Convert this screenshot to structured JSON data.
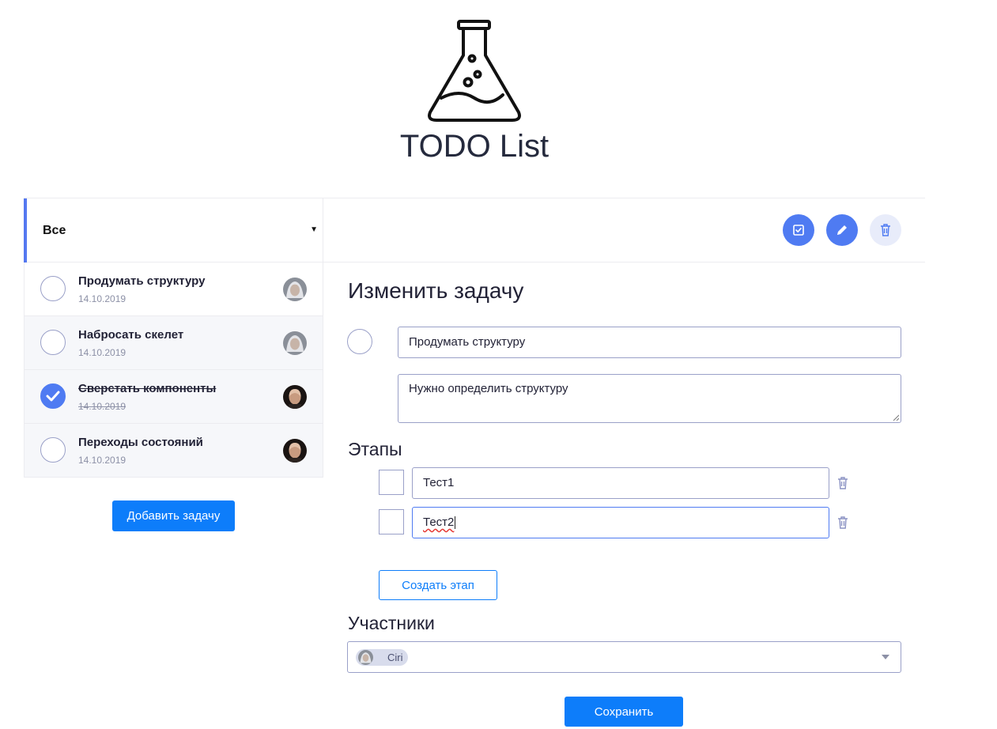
{
  "header": {
    "title": "TODO List",
    "logo_icon": "flask-icon"
  },
  "filter": {
    "label": "Все"
  },
  "toolbar": {
    "icons": [
      "checkbox-icon",
      "pencil-icon",
      "trash-icon"
    ]
  },
  "tasks": [
    {
      "title": "Продумать структуру",
      "date": "14.10.2019",
      "done": false,
      "avatar": "white-haired-avatar"
    },
    {
      "title": "Набросать скелет",
      "date": "14.10.2019",
      "done": false,
      "avatar": "white-haired-avatar"
    },
    {
      "title": "Сверстать компоненты",
      "date": "14.10.2019",
      "done": true,
      "avatar": "bald-man-avatar"
    },
    {
      "title": "Переходы состояний",
      "date": "14.10.2019",
      "done": false,
      "avatar": "bald-man-avatar"
    }
  ],
  "add_task_label": "Добавить задачу",
  "editor": {
    "heading": "Изменить задачу",
    "title_value": "Продумать структуру",
    "description_value": "Нужно определить структуру",
    "stages_heading": "Этапы",
    "stages": [
      {
        "value": "Тест1"
      },
      {
        "value": "Тест2"
      }
    ],
    "create_stage_label": "Создать этап",
    "members_heading": "Участники",
    "members": [
      {
        "name": "Ciri"
      }
    ],
    "save_label": "Сохранить"
  },
  "colors": {
    "accent": "#4f7bf2",
    "primary_button": "#0d7dfa",
    "text": "#222236"
  }
}
